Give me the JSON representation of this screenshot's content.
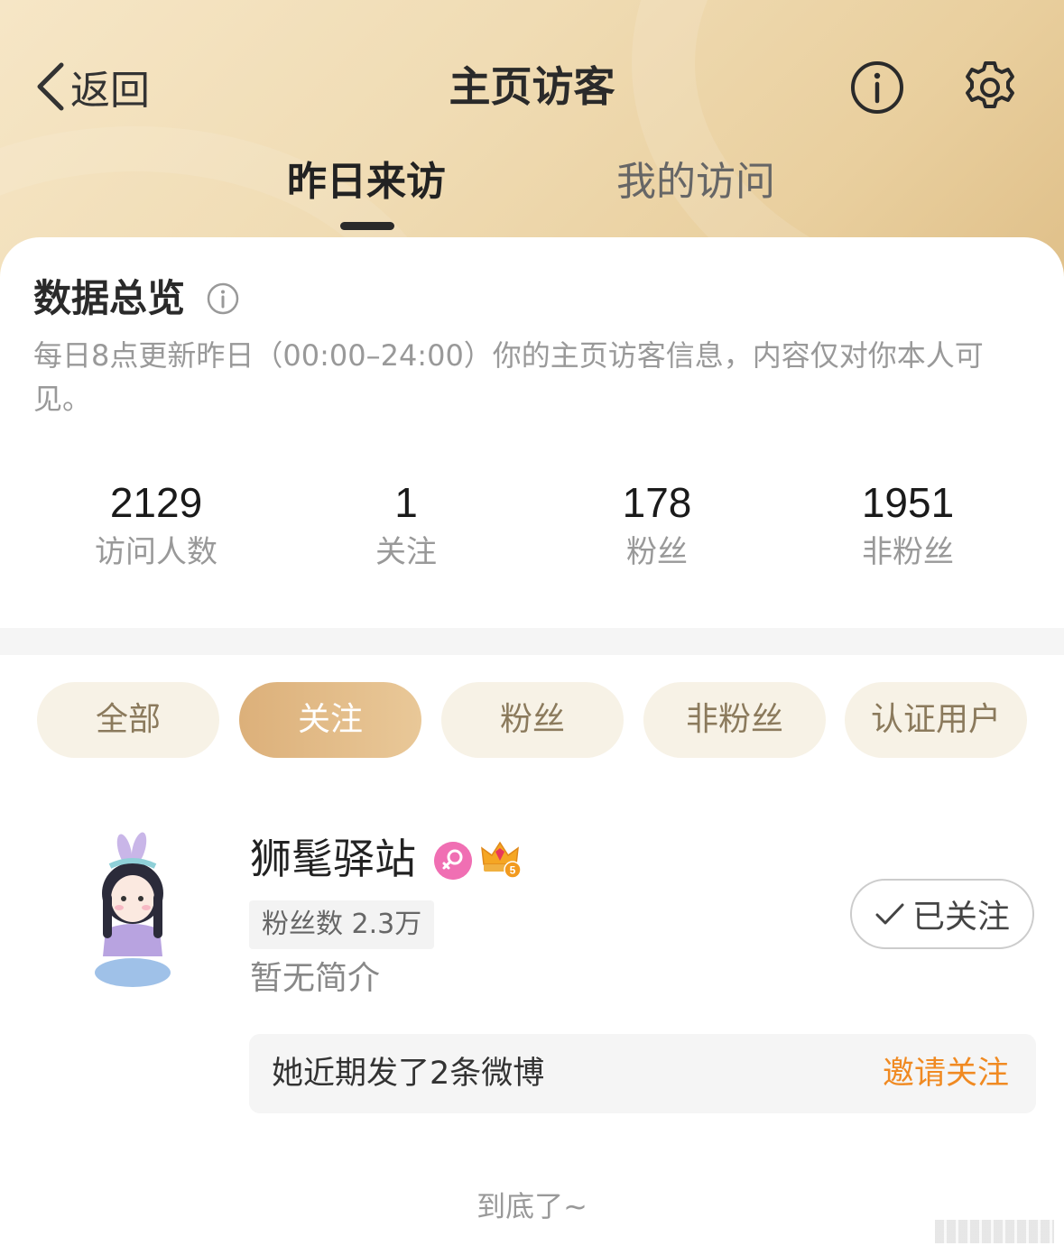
{
  "header": {
    "back_label": "返回",
    "title": "主页访客",
    "tabs": [
      {
        "label": "昨日来访",
        "active": true
      },
      {
        "label": "我的访问",
        "active": false
      }
    ]
  },
  "overview": {
    "title": "数据总览",
    "description": "每日8点更新昨日（00:00–24:00）你的主页访客信息，内容仅对你本人可见。",
    "stats": [
      {
        "value": "2129",
        "label": "访问人数"
      },
      {
        "value": "1",
        "label": "关注"
      },
      {
        "value": "178",
        "label": "粉丝"
      },
      {
        "value": "1951",
        "label": "非粉丝"
      }
    ]
  },
  "filters": [
    {
      "label": "全部",
      "active": false
    },
    {
      "label": "关注",
      "active": true
    },
    {
      "label": "粉丝",
      "active": false
    },
    {
      "label": "非粉丝",
      "active": false
    },
    {
      "label": "认证用户",
      "active": false
    }
  ],
  "visitor": {
    "name": "狮髦驿站",
    "fans_count": "粉丝数 2.3万",
    "bio": "暂无简介",
    "follow_status": "已关注",
    "recent_text": "她近期发了2条微博",
    "invite_label": "邀请关注",
    "badges": [
      "female-badge-icon",
      "vip-crown-icon"
    ],
    "crown_level": "5"
  },
  "footer": {
    "end_text": "到底了~"
  },
  "colors": {
    "accent_gold": "#dcb07a",
    "chip_bg": "#f7f2e6",
    "invite_orange": "#f08a22",
    "female_pink": "#f06fb3"
  }
}
